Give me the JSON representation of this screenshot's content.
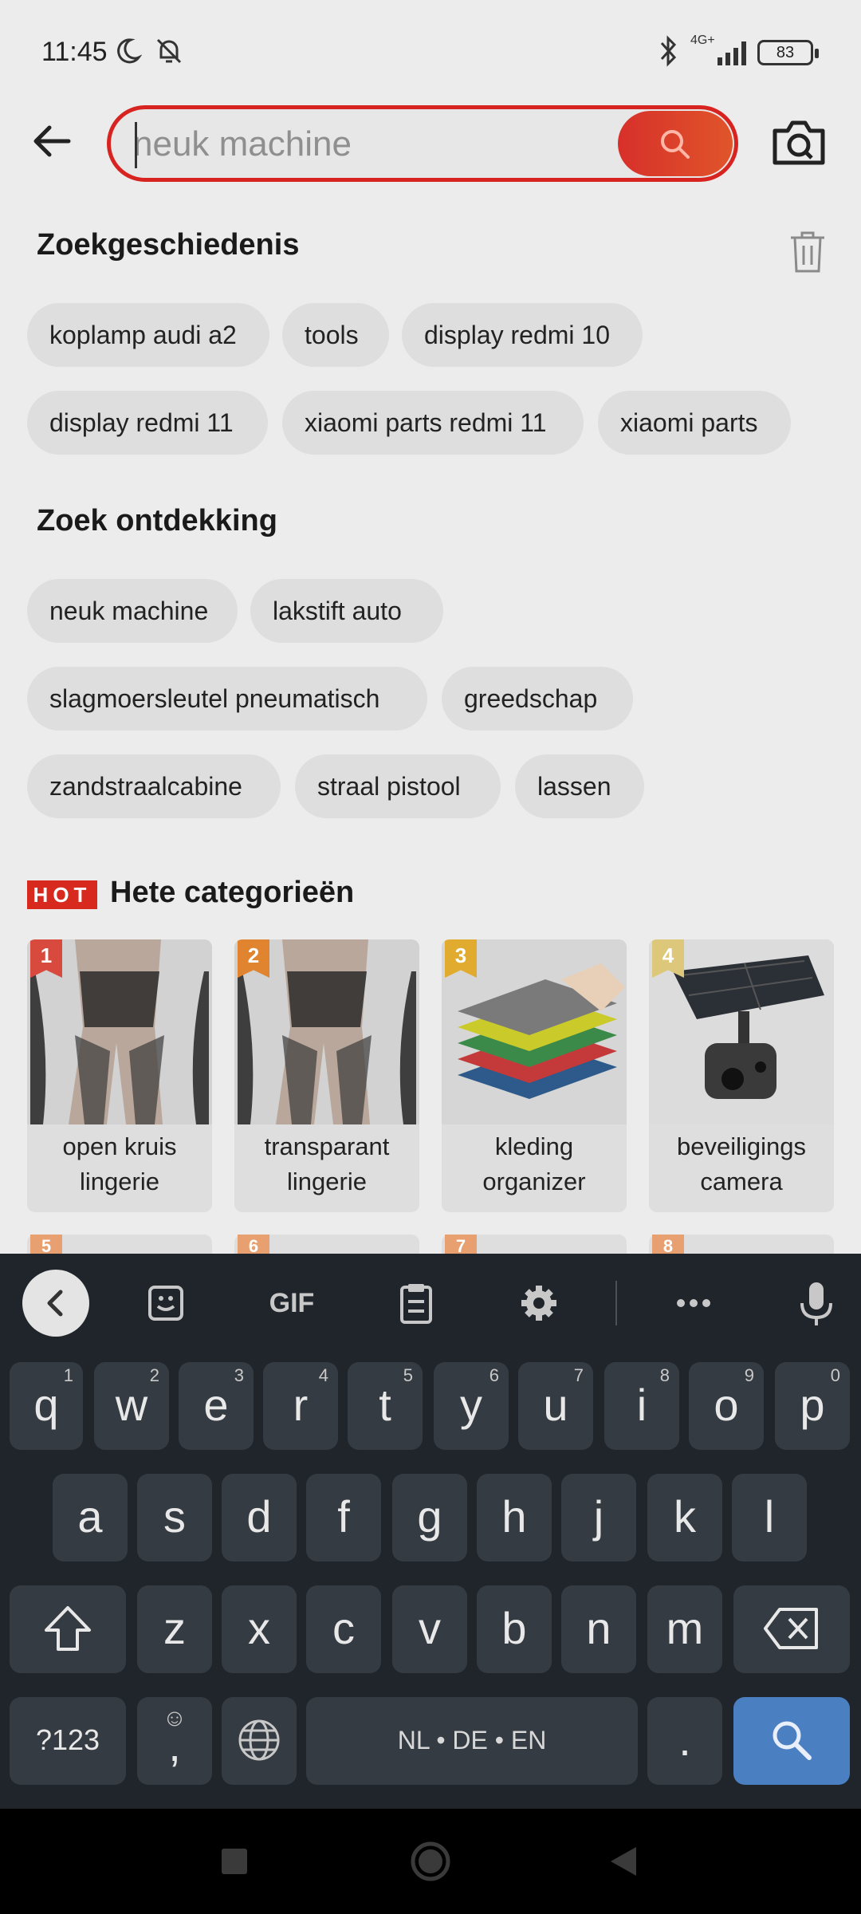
{
  "status_bar": {
    "time": "11:45",
    "network": "4G+",
    "battery": "83"
  },
  "search": {
    "placeholder": "neuk machine",
    "value": ""
  },
  "history": {
    "title": "Zoekgeschiedenis",
    "items": [
      "koplamp audi a2",
      "tools",
      "display redmi 10",
      "display redmi 11",
      "xiaomi parts redmi 11",
      "xiaomi parts"
    ]
  },
  "discovery": {
    "title": "Zoek ontdekking",
    "items": [
      "neuk machine",
      "lakstift auto",
      "slagmoersleutel pneumatisch",
      "greedschap",
      "zandstraalcabine",
      "straal pistool",
      "lassen"
    ]
  },
  "hot": {
    "badge": "HOT",
    "title": "Hete categorieën",
    "cards": [
      {
        "rank": "1",
        "label": "open kruis lingerie",
        "rank_color": "#d84a3e"
      },
      {
        "rank": "2",
        "label": "transparant lingerie",
        "rank_color": "#e0842f"
      },
      {
        "rank": "3",
        "label": "kleding organizer",
        "rank_color": "#e0ab2f"
      },
      {
        "rank": "4",
        "label": "beveiligings camera",
        "rank_color": "#ddc77a"
      }
    ],
    "peek_ranks": [
      "5",
      "6",
      "7",
      "8"
    ]
  },
  "keyboard": {
    "toolbar": {
      "gif": "GIF"
    },
    "row1": [
      {
        "k": "q",
        "h": "1"
      },
      {
        "k": "w",
        "h": "2"
      },
      {
        "k": "e",
        "h": "3"
      },
      {
        "k": "r",
        "h": "4"
      },
      {
        "k": "t",
        "h": "5"
      },
      {
        "k": "y",
        "h": "6"
      },
      {
        "k": "u",
        "h": "7"
      },
      {
        "k": "i",
        "h": "8"
      },
      {
        "k": "o",
        "h": "9"
      },
      {
        "k": "p",
        "h": "0"
      }
    ],
    "row2": [
      "a",
      "s",
      "d",
      "f",
      "g",
      "h",
      "j",
      "k",
      "l"
    ],
    "row3": [
      "z",
      "x",
      "c",
      "v",
      "b",
      "n",
      "m"
    ],
    "symbols": "?123",
    "comma": ",",
    "space": "NL • DE • EN",
    "period": "."
  },
  "colors": {
    "accent": "#d82420",
    "keyboard_bg": "#1f252b",
    "key_bg": "#353b42",
    "search_key": "#4a7fc1"
  }
}
